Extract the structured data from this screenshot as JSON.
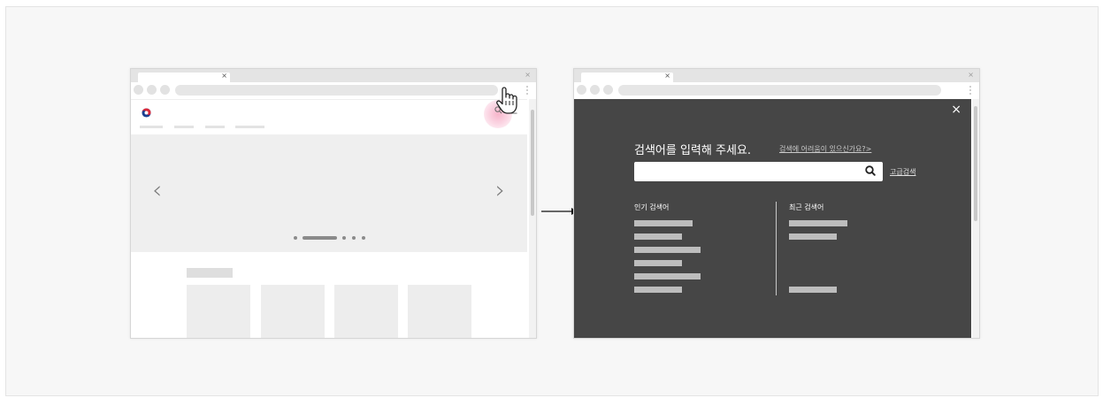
{
  "left_window": {
    "tab_close": "×",
    "window_close": "×",
    "search_icon": "search-icon",
    "user_icon": "user-icon",
    "hero_prev": "‹",
    "hero_next": "›"
  },
  "right_window": {
    "tab_close": "×",
    "window_close": "×",
    "overlay": {
      "close": "×",
      "prompt": "검색어를 입력해 주세요.",
      "help_link": "검색에 어려움이 있으신가요?>",
      "search_value": "",
      "advanced_search": "고급검색",
      "popular_title": "인기 검색어",
      "recent_title": "최근 검색어"
    }
  },
  "colors": {
    "overlay_bg": "#464646",
    "highlight": "#f28bb0",
    "frame_bg": "#f7f7f7"
  }
}
